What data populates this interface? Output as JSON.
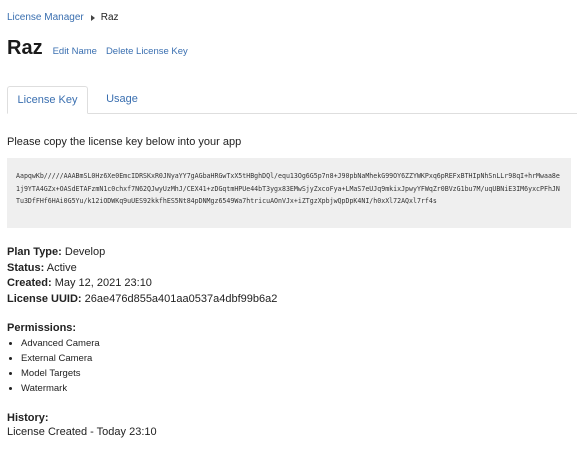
{
  "breadcrumb": {
    "parent_label": "License Manager",
    "current_label": "Raz"
  },
  "header": {
    "title": "Raz",
    "edit_name_label": "Edit Name",
    "delete_key_label": "Delete License Key"
  },
  "tabs": [
    {
      "label": "License Key",
      "active": true
    },
    {
      "label": "Usage",
      "active": false
    }
  ],
  "license": {
    "instruction": "Please copy the license key below into your app",
    "key_text": "AapqwKb/////AAABmSL0Hz6Xe0EmcIDRSKxR0JNyaYY7gAGbaHRGwTxX5tHBghDQl/equ13Og6G5p7n8+J90pbNaMhekG99OY6ZZYWKPxq6pREFxBTHIpNhSnLLr98qI+hrMwaa8e1j9YTA4GZx+OASdETAFzmN1c0chxf7N62QJwyUzMhJ/CEX41+zDGqtmHPUe44bT3ygx83EMwSjyZxcoFya+LMaS7eUJq9mkixJpwyYFWqZr0BVzG1bu7M/uqUBNiE3IM6yxcPFhJNTu3DfFHf6HAi0G5Yu/k12iODWKq9uUES92kkfhES5Nt84pDNMgz6549Wa7htricuAOnVJx+iZTgzXpbjwQpDpK4NI/h0xXl72AQxl7rf4s",
    "plan_type_label": "Plan Type:",
    "plan_type_value": "Develop",
    "status_label": "Status:",
    "status_value": "Active",
    "created_label": "Created:",
    "created_value": "May 12, 2021 23:10",
    "uuid_label": "License UUID:",
    "uuid_value": "26ae476d855a401aa0537a4dbf99b6a2"
  },
  "permissions": {
    "title": "Permissions:",
    "items": [
      "Advanced Camera",
      "External Camera",
      "Model Targets",
      "Watermark"
    ]
  },
  "history": {
    "title": "History:",
    "entries": [
      "License Created - Today 23:10"
    ]
  },
  "colors": {
    "link": "#3a6fb0",
    "key_box_bg": "#efefef",
    "text": "#222222"
  }
}
